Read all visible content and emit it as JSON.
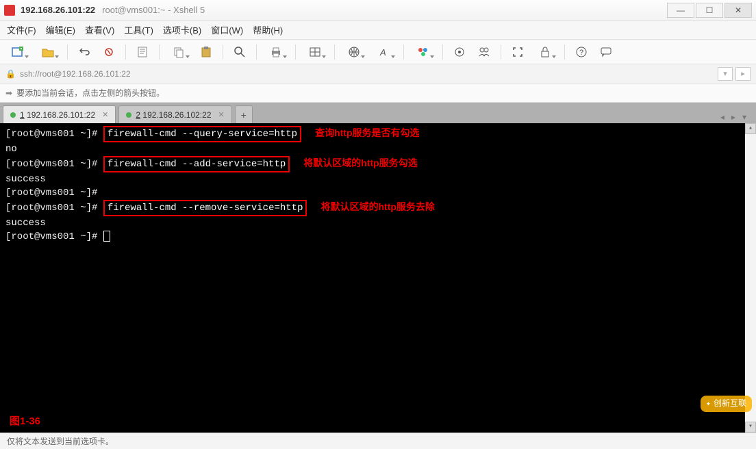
{
  "window": {
    "title_main": "192.168.26.101:22",
    "title_sub": "root@vms001:~ - Xshell 5"
  },
  "menu": {
    "file": "文件(F)",
    "edit": "编辑(E)",
    "view": "查看(V)",
    "tools": "工具(T)",
    "tabs": "选项卡(B)",
    "window": "窗口(W)",
    "help": "帮助(H)"
  },
  "address": {
    "url": "ssh://root@192.168.26.101:22"
  },
  "hint": {
    "text": "要添加当前会话，点击左侧的箭头按钮。"
  },
  "tabs": [
    {
      "index": "1",
      "label": "192.168.26.101:22",
      "active": true
    },
    {
      "index": "2",
      "label": "192.168.26.102:22",
      "active": false
    }
  ],
  "terminal": {
    "prompt": "[root@vms001 ~]#",
    "lines": [
      {
        "prompt": "[root@vms001 ~]#",
        "cmd": "firewall-cmd --query-service=http",
        "anno": "查询http服务是否有勾选",
        "boxed": true
      },
      {
        "text": "no"
      },
      {
        "prompt": "[root@vms001 ~]#",
        "cmd": "firewall-cmd --add-service=http",
        "anno": "将默认区域的http服务勾选",
        "boxed": true
      },
      {
        "text": "success"
      },
      {
        "prompt": "[root@vms001 ~]#",
        "text_after": ""
      },
      {
        "prompt": "[root@vms001 ~]#",
        "cmd": "firewall-cmd --remove-service=http",
        "anno": "将默认区域的http服务去除",
        "boxed": true
      },
      {
        "text": "success"
      },
      {
        "prompt": "[root@vms001 ~]#",
        "cursor": true
      }
    ],
    "figure_label": "图1-36"
  },
  "watermark": "创新互联",
  "status": {
    "text": "仅将文本发送到当前选项卡。"
  }
}
